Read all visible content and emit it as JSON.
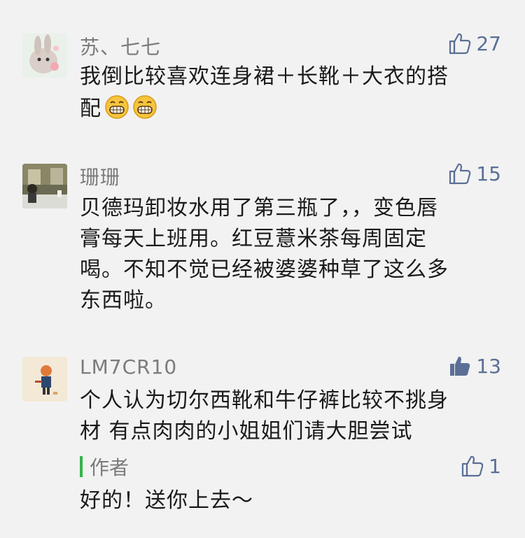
{
  "comments": [
    {
      "name": "苏、七七",
      "text_line1": "我倒比较喜欢连身裙＋长靴＋大衣的搭",
      "text_line2": "配",
      "emojis": [
        "grin-emoji",
        "grin-emoji"
      ],
      "likes": "27",
      "liked": false
    },
    {
      "name": "珊珊",
      "lines": [
        "贝德玛卸妆水用了第三瓶了，，变色唇",
        "膏每天上班用。红豆薏米茶每周固定",
        "喝。不知不觉已经被婆婆种草了这么多",
        "东西啦。"
      ],
      "likes": "15",
      "liked": false
    },
    {
      "name": "LM7CR10",
      "lines": [
        "个人认为切尔西靴和牛仔裤比较不挑身",
        "材 有点肉肉的小姐姐们请大胆尝试"
      ],
      "likes": "13",
      "liked": true,
      "reply": {
        "author_label": "作者",
        "text": "好的！送你上去～",
        "likes": "1"
      }
    }
  ],
  "colors": {
    "background": "#f2f2f2",
    "name": "#7b7b7b",
    "like": "#5b6f96",
    "author_bar": "#32b34a"
  }
}
